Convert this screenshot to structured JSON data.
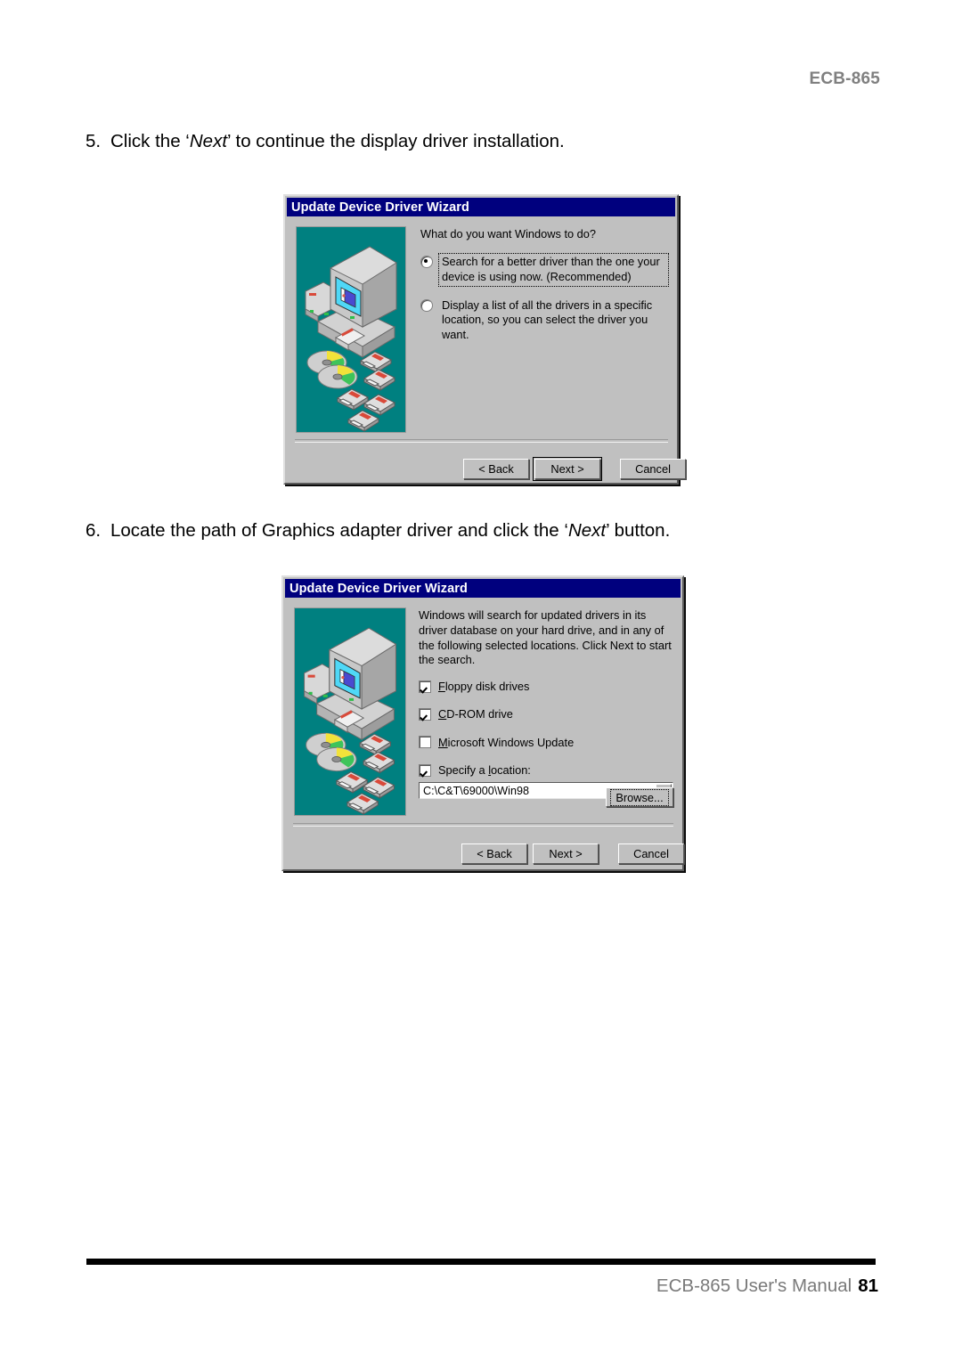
{
  "page": {
    "header_model": "ECB-865",
    "footer_text": "ECB-865 User's Manual",
    "page_number": "81",
    "colors": {
      "header_gray": "#808080",
      "title_bar_blue": "#00007e",
      "dialog_face": "#c0c0c0",
      "wizard_art_teal": "#008080"
    }
  },
  "steps": [
    {
      "number": "5.",
      "text_before": "Click the ‘",
      "emphasis": "Next",
      "text_after": "’ to continue the display driver installation."
    },
    {
      "number": "6.",
      "text_before": "Locate the path of Graphics adapter driver and click the ‘",
      "emphasis": "Next",
      "text_after": "’ button."
    }
  ],
  "dialog1": {
    "title": "Update Device Driver Wizard",
    "prompt": "What do you want Windows to do?",
    "options": [
      {
        "label": "Search for a better driver than the one your device is using now. (Recommended)",
        "selected": true,
        "focused": true
      },
      {
        "label": "Display a list of all the drivers in a specific location, so you can select the driver you want.",
        "selected": false,
        "focused": false
      }
    ],
    "buttons": {
      "back": "< Back",
      "next": "Next >",
      "cancel": "Cancel",
      "default": "Next >"
    }
  },
  "dialog2": {
    "title": "Update Device Driver Wizard",
    "prompt": "Windows will search for updated drivers in its driver database on your hard drive, and in any of the following selected locations. Click Next to start the search.",
    "checkboxes": [
      {
        "label": "Floppy disk drives",
        "accel": "F",
        "checked": true
      },
      {
        "label": "CD-ROM drive",
        "accel": "C",
        "checked": true
      },
      {
        "label": "Microsoft Windows Update",
        "accel": "M",
        "checked": false
      },
      {
        "label": "Specify a location:",
        "accel": "l",
        "checked": true
      }
    ],
    "location_value": "C:\\C&T\\69000\\Win98",
    "browse_button": "Browse...",
    "buttons": {
      "back": "< Back",
      "next": "Next >",
      "cancel": "Cancel"
    }
  }
}
